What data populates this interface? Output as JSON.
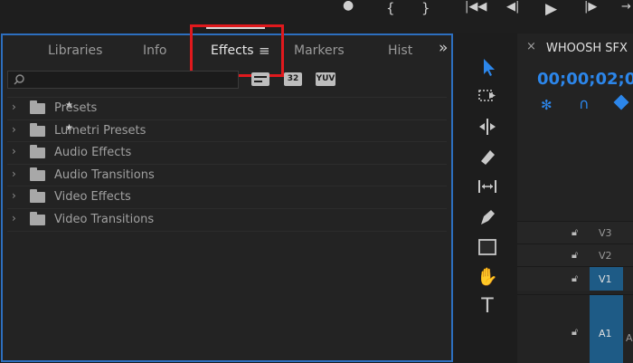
{
  "transport": {
    "buttons": [
      "●",
      "{",
      "}",
      "|◀◀",
      "◀|",
      "▶",
      "|▶",
      "→"
    ]
  },
  "effects_panel": {
    "tabs": [
      "Libraries",
      "Info",
      "Effects",
      "Markers",
      "Hist"
    ],
    "active_tab": "Effects",
    "tab_menu_glyph": "≡",
    "overflow_glyph": "»",
    "search": {
      "value": "",
      "placeholder": ""
    },
    "filter_badges": [
      "32",
      "YUV"
    ],
    "tree": [
      {
        "label": "Presets",
        "starred": true
      },
      {
        "label": "Lumetri Presets",
        "starred": true
      },
      {
        "label": "Audio Effects",
        "starred": false
      },
      {
        "label": "Audio Transitions",
        "starred": false
      },
      {
        "label": "Video Effects",
        "starred": false
      },
      {
        "label": "Video Transitions",
        "starred": false
      }
    ]
  },
  "tools": [
    "selection-tool",
    "track-select-tool",
    "ripple-edit-tool",
    "razor-tool",
    "slip-tool",
    "pen-tool",
    "rectangle-tool",
    "hand-tool",
    "type-tool"
  ],
  "sequence": {
    "close_glyph": "×",
    "title": "WHOOSH SFX",
    "timecode": "00;00;02;00",
    "tracks": [
      {
        "label": "V3"
      },
      {
        "label": "V2"
      },
      {
        "label": "V1"
      },
      {
        "label": "A1",
        "extra": "A"
      }
    ],
    "accent_color": "#2c86ea",
    "track_target_color": "#1e5b86"
  }
}
